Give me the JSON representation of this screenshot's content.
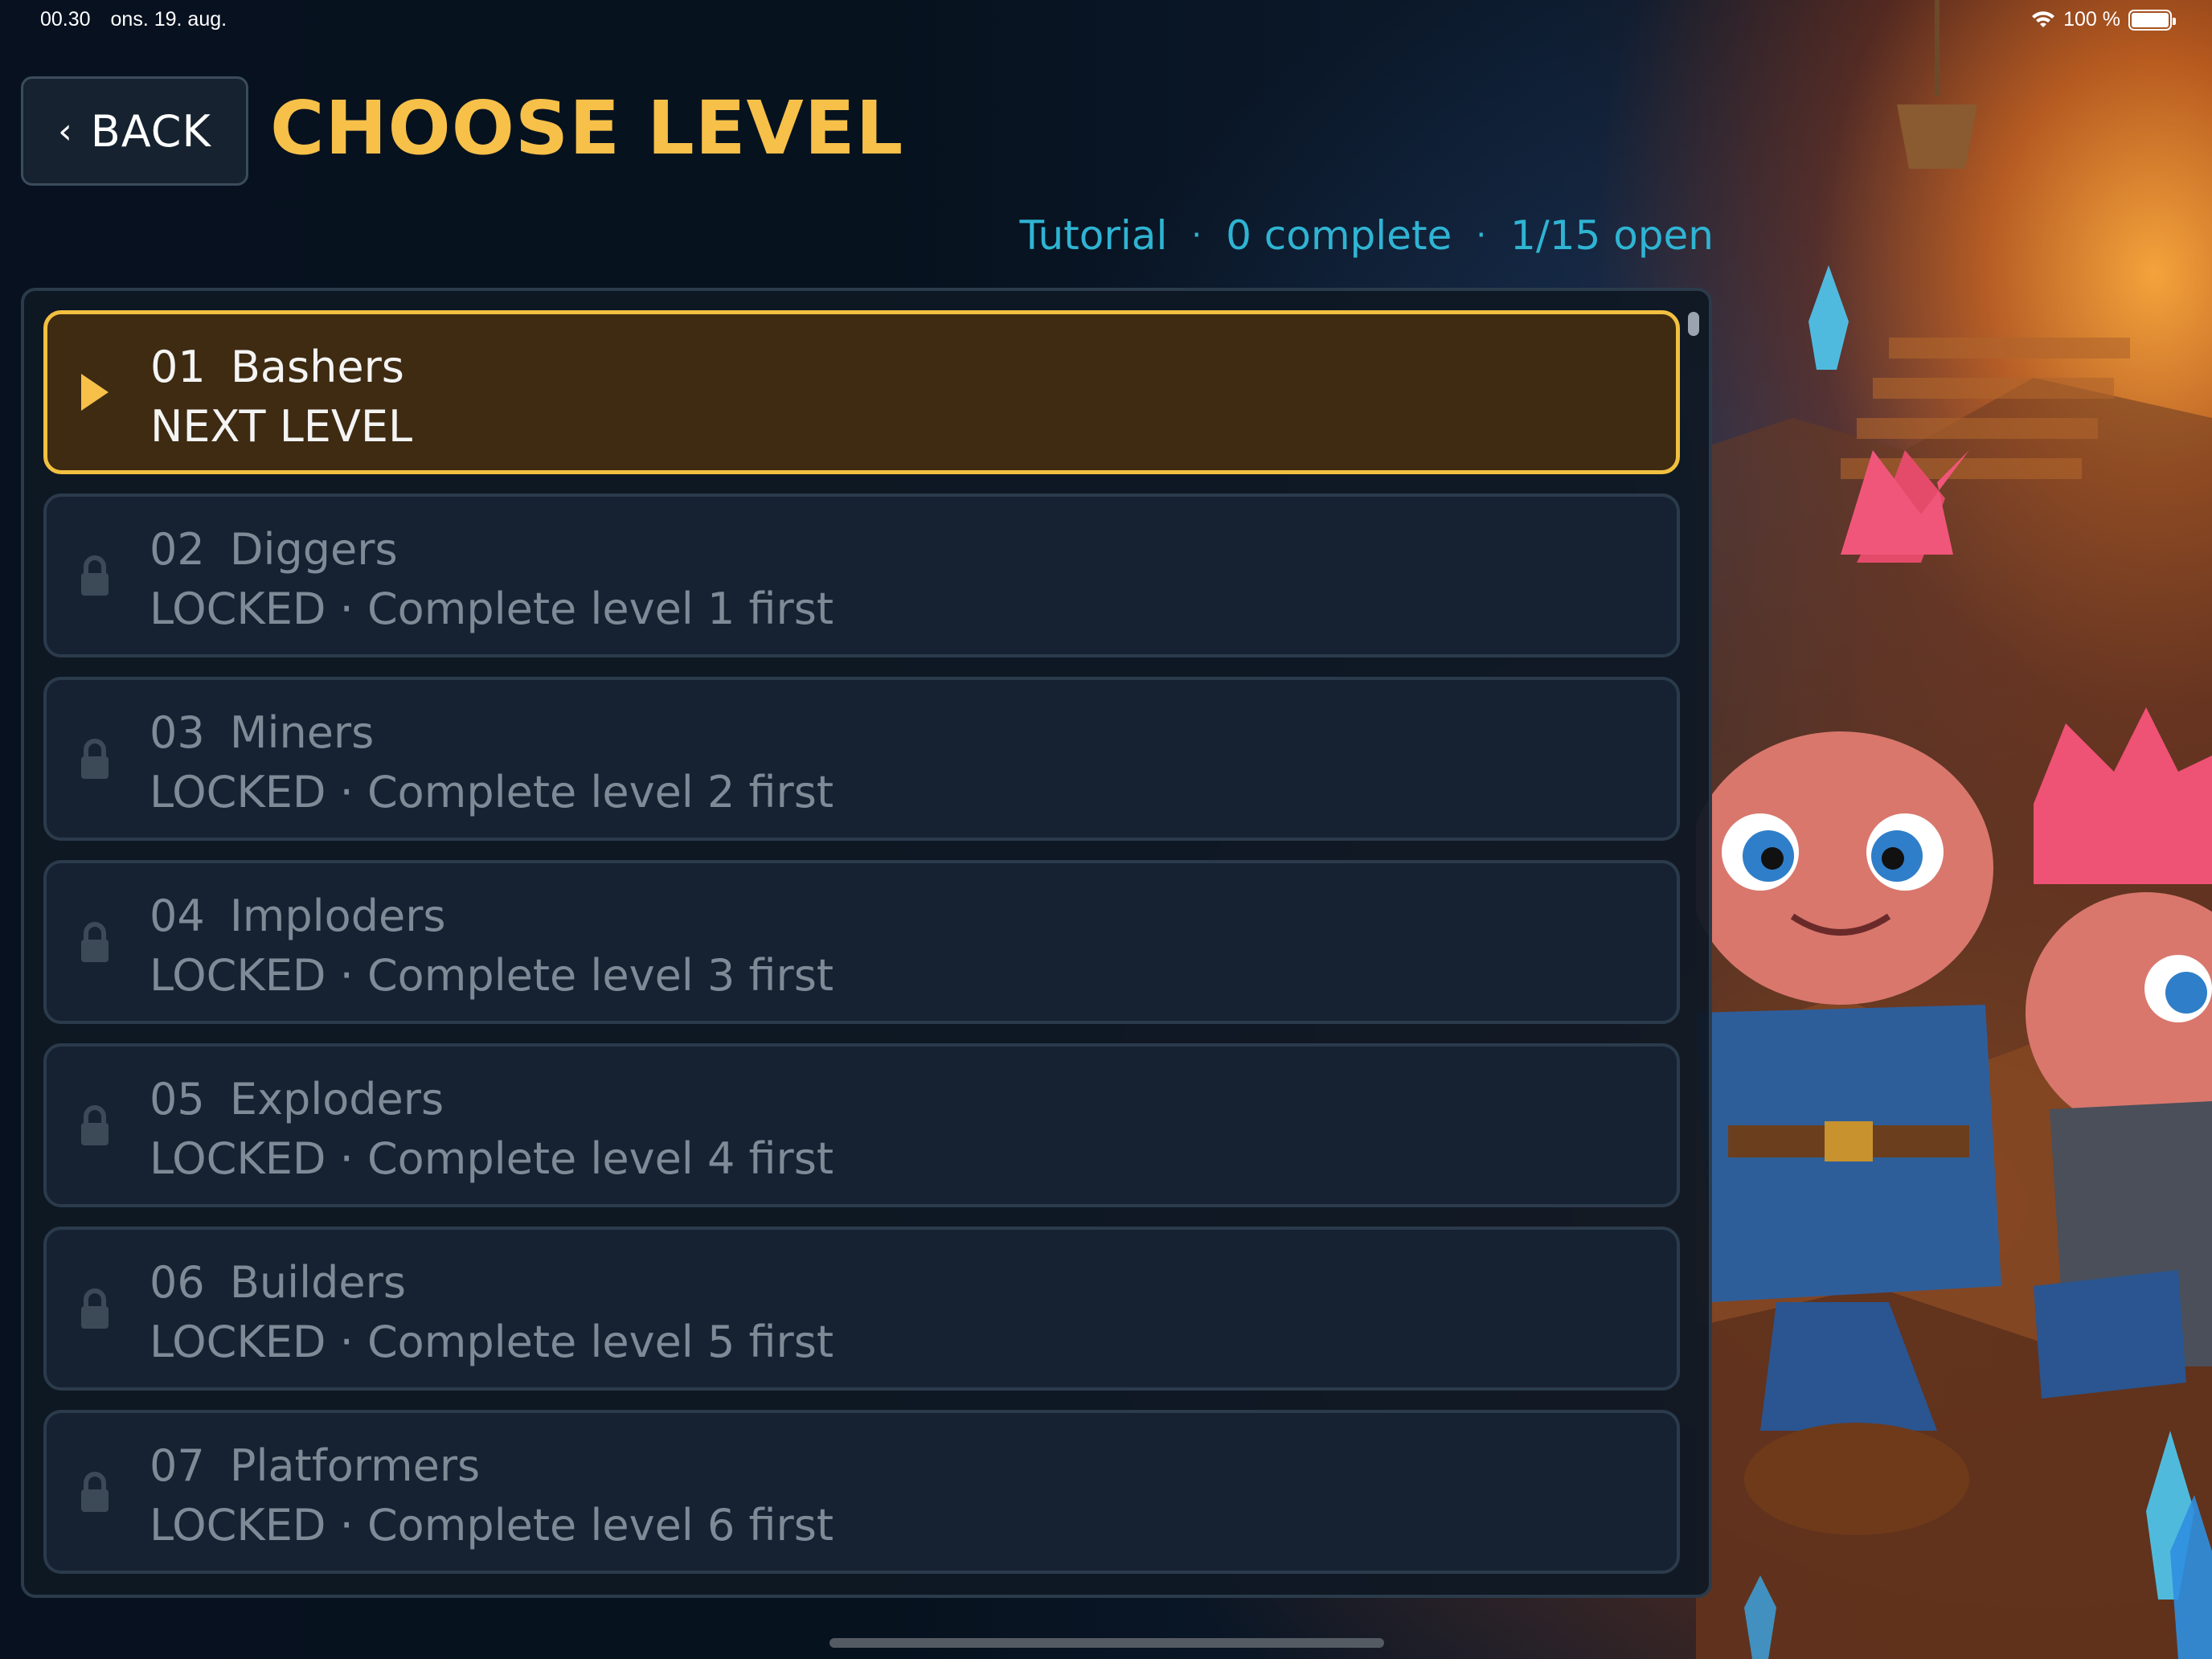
{
  "status_bar": {
    "time": "00.30",
    "date": "ons. 19. aug.",
    "battery": "100 %"
  },
  "header": {
    "back_label": "BACK",
    "title": "CHOOSE LEVEL"
  },
  "summary": {
    "pack": "Tutorial",
    "completed": "0 complete",
    "open": "1/15 open",
    "separator": "·"
  },
  "levels": [
    {
      "number": "01",
      "name": "Bashers",
      "status": "NEXT LEVEL",
      "state": "next",
      "icon": "play-icon"
    },
    {
      "number": "02",
      "name": "Diggers",
      "status": "LOCKED · Complete level 1 first",
      "state": "locked",
      "icon": "lock-icon"
    },
    {
      "number": "03",
      "name": "Miners",
      "status": "LOCKED · Complete level 2 first",
      "state": "locked",
      "icon": "lock-icon"
    },
    {
      "number": "04",
      "name": "Imploders",
      "status": "LOCKED · Complete level 3 first",
      "state": "locked",
      "icon": "lock-icon"
    },
    {
      "number": "05",
      "name": "Exploders",
      "status": "LOCKED · Complete level 4 first",
      "state": "locked",
      "icon": "lock-icon"
    },
    {
      "number": "06",
      "name": "Builders",
      "status": "LOCKED · Complete level 5 first",
      "state": "locked",
      "icon": "lock-icon"
    },
    {
      "number": "07",
      "name": "Platformers",
      "status": "LOCKED · Complete level 6 first",
      "state": "locked",
      "icon": "lock-icon"
    }
  ],
  "colors": {
    "accent": "#f6c049",
    "summary_text": "#2fb4d3",
    "active_row": "#3e2b12",
    "locked_text": "#7e8b97"
  }
}
